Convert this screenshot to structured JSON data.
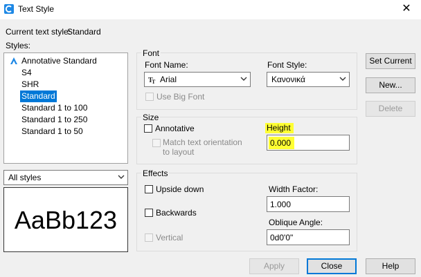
{
  "window": {
    "title": "Text Style",
    "close_glyph": "✕"
  },
  "current_style": {
    "label": "Current text style:",
    "value": "Standard"
  },
  "styles": {
    "label": "Styles:",
    "items": [
      {
        "label": "Annotative Standard",
        "icon": "annotative-icon",
        "selected": false
      },
      {
        "label": "S4",
        "selected": false
      },
      {
        "label": "SHR",
        "selected": false
      },
      {
        "label": "Standard",
        "selected": true
      },
      {
        "label": "Standard 1 to 100",
        "selected": false
      },
      {
        "label": "Standard 1 to 250",
        "selected": false
      },
      {
        "label": "Standard 1 to 50",
        "selected": false
      }
    ],
    "filter_value": "All styles"
  },
  "preview": {
    "text": "AaBb123"
  },
  "font": {
    "group_label": "Font",
    "name_label": "Font Name:",
    "name_value": "Arial",
    "name_icon": "truetype-icon",
    "style_label": "Font Style:",
    "style_value": "Κανονικά",
    "big_font_label": "Use Big Font"
  },
  "size": {
    "group_label": "Size",
    "annotative_label": "Annotative",
    "match_label_line1": "Match text orientation",
    "match_label_line2": "to layout",
    "height_label": "Height",
    "height_value": "0.000",
    "highlight_color": "#ffff33"
  },
  "effects": {
    "group_label": "Effects",
    "upside_down_label": "Upside down",
    "backwards_label": "Backwards",
    "vertical_label": "Vertical",
    "width_label": "Width Factor:",
    "width_value": "1.000",
    "oblique_label": "Oblique Angle:",
    "oblique_value": "0d0'0\""
  },
  "buttons": {
    "set_current": "Set Current",
    "new": "New...",
    "delete": "Delete",
    "apply": "Apply",
    "close": "Close",
    "help": "Help"
  },
  "colors": {
    "selection": "#0078d7",
    "app_icon": "#1e88e5"
  }
}
